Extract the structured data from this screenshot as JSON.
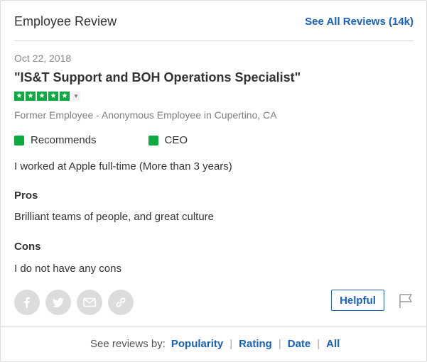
{
  "header": {
    "title": "Employee Review",
    "see_all_label": "See All Reviews (14k)"
  },
  "review": {
    "date": "Oct 22, 2018",
    "title": "\"IS&T Support and BOH Operations Specialist\"",
    "rating": 5,
    "meta": "Former Employee - Anonymous Employee in Cupertino, CA",
    "flags": [
      "Recommends",
      "CEO"
    ],
    "employment": "I worked at Apple full-time (More than 3 years)",
    "pros_label": "Pros",
    "pros_text": "Brilliant teams of people, and great culture",
    "cons_label": "Cons",
    "cons_text": "I do not have any cons"
  },
  "actions": {
    "helpful_label": "Helpful",
    "share_icons": [
      "facebook-icon",
      "twitter-icon",
      "email-icon",
      "link-icon"
    ]
  },
  "footer": {
    "label": "See reviews by:",
    "links": [
      "Popularity",
      "Rating",
      "Date",
      "All"
    ]
  },
  "colors": {
    "accent_blue": "#1861bf",
    "rating_green": "#0caa41",
    "icon_gray": "#dcdcdc"
  }
}
